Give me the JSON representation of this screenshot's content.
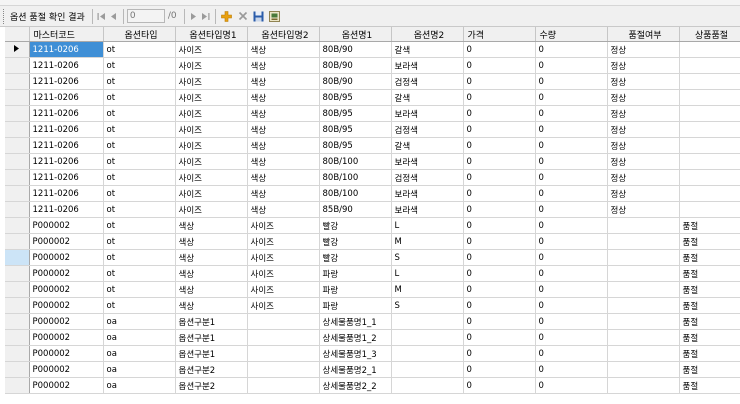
{
  "toolbar": {
    "title": "옵션 품절 확인 결과",
    "position_value": "0",
    "count_label": "/0"
  },
  "colors": {
    "current_cell": "#3f8fd6",
    "selected_row_header": "#cce4f7",
    "add_icon": "#e8a010",
    "delete_icon": "#999999"
  },
  "grid": {
    "columns": [
      "마스터코드",
      "옵션타입",
      "옵션타입명1",
      "옵션타입명2",
      "옵션명1",
      "옵션명2",
      "가격",
      "수량",
      "품절여부",
      "상품품절"
    ],
    "rows": [
      [
        "1211-0206",
        "ot",
        "사이즈",
        "색상",
        "80B/90",
        "갈색",
        "0",
        "0",
        "정상",
        ""
      ],
      [
        "1211-0206",
        "ot",
        "사이즈",
        "색상",
        "80B/90",
        "보라색",
        "0",
        "0",
        "정상",
        ""
      ],
      [
        "1211-0206",
        "ot",
        "사이즈",
        "색상",
        "80B/90",
        "검정색",
        "0",
        "0",
        "정상",
        ""
      ],
      [
        "1211-0206",
        "ot",
        "사이즈",
        "색상",
        "80B/95",
        "갈색",
        "0",
        "0",
        "정상",
        ""
      ],
      [
        "1211-0206",
        "ot",
        "사이즈",
        "색상",
        "80B/95",
        "보라색",
        "0",
        "0",
        "정상",
        ""
      ],
      [
        "1211-0206",
        "ot",
        "사이즈",
        "색상",
        "80B/95",
        "검정색",
        "0",
        "0",
        "정상",
        ""
      ],
      [
        "1211-0206",
        "ot",
        "사이즈",
        "색상",
        "80B/95",
        "갈색",
        "0",
        "0",
        "정상",
        ""
      ],
      [
        "1211-0206",
        "ot",
        "사이즈",
        "색상",
        "80B/100",
        "보라색",
        "0",
        "0",
        "정상",
        ""
      ],
      [
        "1211-0206",
        "ot",
        "사이즈",
        "색상",
        "80B/100",
        "검정색",
        "0",
        "0",
        "정상",
        ""
      ],
      [
        "1211-0206",
        "ot",
        "사이즈",
        "색상",
        "80B/100",
        "보라색",
        "0",
        "0",
        "정상",
        ""
      ],
      [
        "1211-0206",
        "ot",
        "사이즈",
        "색상",
        "85B/90",
        "보라색",
        "0",
        "0",
        "정상",
        ""
      ],
      [
        "P000002",
        "ot",
        "색상",
        "사이즈",
        "빨강",
        "L",
        "0",
        "0",
        "",
        "품절"
      ],
      [
        "P000002",
        "ot",
        "색상",
        "사이즈",
        "빨강",
        "M",
        "0",
        "0",
        "",
        "품절"
      ],
      [
        "P000002",
        "ot",
        "색상",
        "사이즈",
        "빨강",
        "S",
        "0",
        "0",
        "",
        "품절"
      ],
      [
        "P000002",
        "ot",
        "색상",
        "사이즈",
        "파랑",
        "L",
        "0",
        "0",
        "",
        "품절"
      ],
      [
        "P000002",
        "ot",
        "색상",
        "사이즈",
        "파랑",
        "M",
        "0",
        "0",
        "",
        "품절"
      ],
      [
        "P000002",
        "ot",
        "색상",
        "사이즈",
        "파랑",
        "S",
        "0",
        "0",
        "",
        "품절"
      ],
      [
        "P000002",
        "oa",
        "옵션구분1",
        "",
        "상세물품명1_1",
        "",
        "0",
        "0",
        "",
        "품절"
      ],
      [
        "P000002",
        "oa",
        "옵션구분1",
        "",
        "상세물품명1_2",
        "",
        "0",
        "0",
        "",
        "품절"
      ],
      [
        "P000002",
        "oa",
        "옵션구분1",
        "",
        "상세물품명1_3",
        "",
        "0",
        "0",
        "",
        "품절"
      ],
      [
        "P000002",
        "oa",
        "옵션구분2",
        "",
        "상세물품명2_1",
        "",
        "0",
        "0",
        "",
        "품절"
      ],
      [
        "P000002",
        "oa",
        "옵션구분2",
        "",
        "상세물품명2_2",
        "",
        "0",
        "0",
        "",
        "품절"
      ]
    ]
  }
}
